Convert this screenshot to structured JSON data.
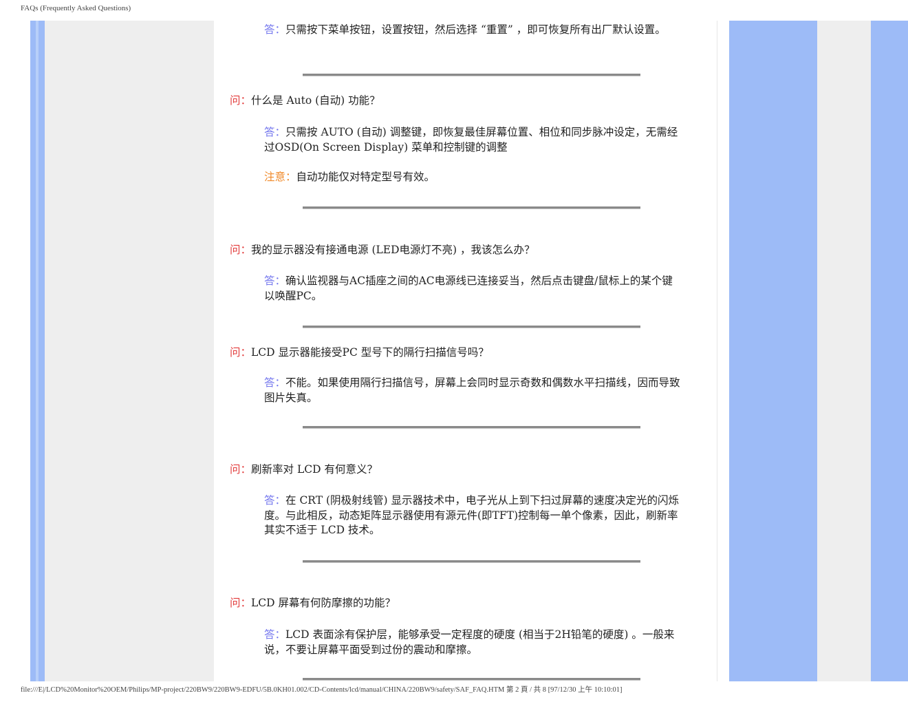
{
  "header": {
    "title": "FAQs (Frequently Asked Questions)"
  },
  "footer": {
    "path": "file:///E|/LCD%20Monitor%20OEM/Philips/MP-project/220BW9/220BW9-EDFU/5B.0KH01.002/CD-Contents/lcd/manual/CHINA/220BW9/safety/SAF_FAQ.HTM 第 2 頁 / 共 8  [97/12/30 上午 10:10:01]"
  },
  "faq": {
    "a0": {
      "tag": "答：",
      "text": "只需按下菜单按钮，设置按钮，然后选择 “重置” ，即可恢复所有出厂默认设置。"
    },
    "q1": {
      "tag": "问：",
      "text": "什么是 Auto (自动) 功能？"
    },
    "a1": {
      "tag": "答：",
      "text": "只需按 AUTO (自动) 调整键，即恢复最佳屏幕位置、相位和同步脉冲设定，无需经过OSD(On Screen Display) 菜单和控制键的调整"
    },
    "n1": {
      "tag": "注意：",
      "text": "自动功能仅对特定型号有效。"
    },
    "q2": {
      "tag": "问：",
      "text": "我的显示器没有接通电源 (LED电源灯不亮) ，我该怎么办？"
    },
    "a2": {
      "tag": "答：",
      "text": "确认监视器与AC插座之间的AC电源线已连接妥当，然后点击键盘/鼠标上的某个键以唤醒PC。"
    },
    "q3": {
      "tag": "问：",
      "text": "LCD 显示器能接受PC 型号下的隔行扫描信号吗？"
    },
    "a3": {
      "tag": "答：",
      "text": "不能。如果使用隔行扫描信号，屏幕上会同时显示奇数和偶数水平扫描线，因而导致图片失真。"
    },
    "q4": {
      "tag": "问：",
      "text": "刷新率对 LCD 有何意义？"
    },
    "a4": {
      "tag": "答：",
      "text": "在 CRT (阴极射线管) 显示器技术中，电子光从上到下扫过屏幕的速度决定光的闪烁度。与此相反，动态矩阵显示器使用有源元件(即TFT)控制每一单个像素，因此，刷新率其实不适于 LCD 技术。"
    },
    "q5": {
      "tag": "问：",
      "text": "LCD 屏幕有何防摩擦的功能？"
    },
    "a5": {
      "tag": "答：",
      "text": "LCD 表面涂有保护层，能够承受一定程度的硬度 (相当于2H铅笔的硬度) 。一般来说，不要让屏幕平面受到过份的震动和摩擦。"
    }
  }
}
